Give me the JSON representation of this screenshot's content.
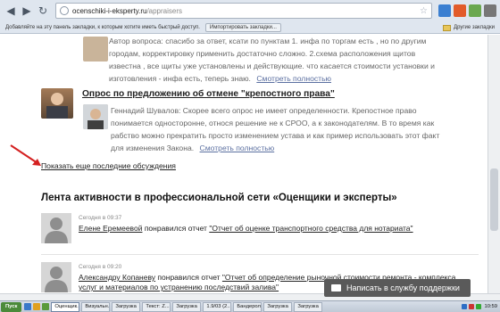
{
  "browser": {
    "url_host": "ocenschiki-i-eksperty.ru",
    "url_path": "/appraisers",
    "bookmarks_prompt": "Добавляйте на эту панель закладки, к которым хотите иметь быстрый доступ.",
    "import_label": "Импортировать закладки...",
    "other_bookmarks": "Другие закладки"
  },
  "thread1": {
    "text": "Автор вопроса:  спасибо за ответ, ксати по пунктам 1. инфа по торгам есть , но по другим городам, корректировку применить достаточно сложно. 2.схема расположения щитов известна , все щиты уже установлены и действующие. что касается стоимости установки и изготовления - инфа есть, теперь знаю.",
    "more": "Смотреть полностью"
  },
  "thread2": {
    "title": "Опрос по предложению об отмене \"крепостного права\"",
    "text": "Геннадий Шувалов:  Скорее всего опрос не имеет определенности. Крепостное право понимается односторонне, относя решение не к СРОО, а к законодателям. В то время как рабство можно прекратить просто изменением устава и как пример использовать этот факт для изменения Закона.",
    "more": "Смотреть полностью"
  },
  "show_more": "Показать еще последние обсуждения",
  "feed": {
    "title": "Лента активности в профессиональной сети «Оценщики и эксперты»",
    "items": [
      {
        "time": "Сегодня в 09:37",
        "user": "Елене Еремеевой",
        "verb": " понравился отчет ",
        "report": "\"Отчет об оценке транспортного средства для нотариата\""
      },
      {
        "time": "Сегодня в 09:20",
        "user": "Александру Копаневу",
        "verb": " понравился отчет ",
        "report": "\"Отчет об определение рыночной стоимости ремонта - комплекса услуг и материалов по устранению последствий залива\""
      }
    ]
  },
  "support_button": "Написать в службу поддержки",
  "taskbar": {
    "start": "Пуск",
    "tasks": [
      "Оценщик...",
      "Визуальн...",
      "Загрузка",
      "Текст: Z...",
      "Загрузка",
      "1.9/03 (2...",
      "Бандерол...",
      "Загрузка",
      "Загрузка"
    ],
    "active_index": 0,
    "clock": "10:59"
  }
}
